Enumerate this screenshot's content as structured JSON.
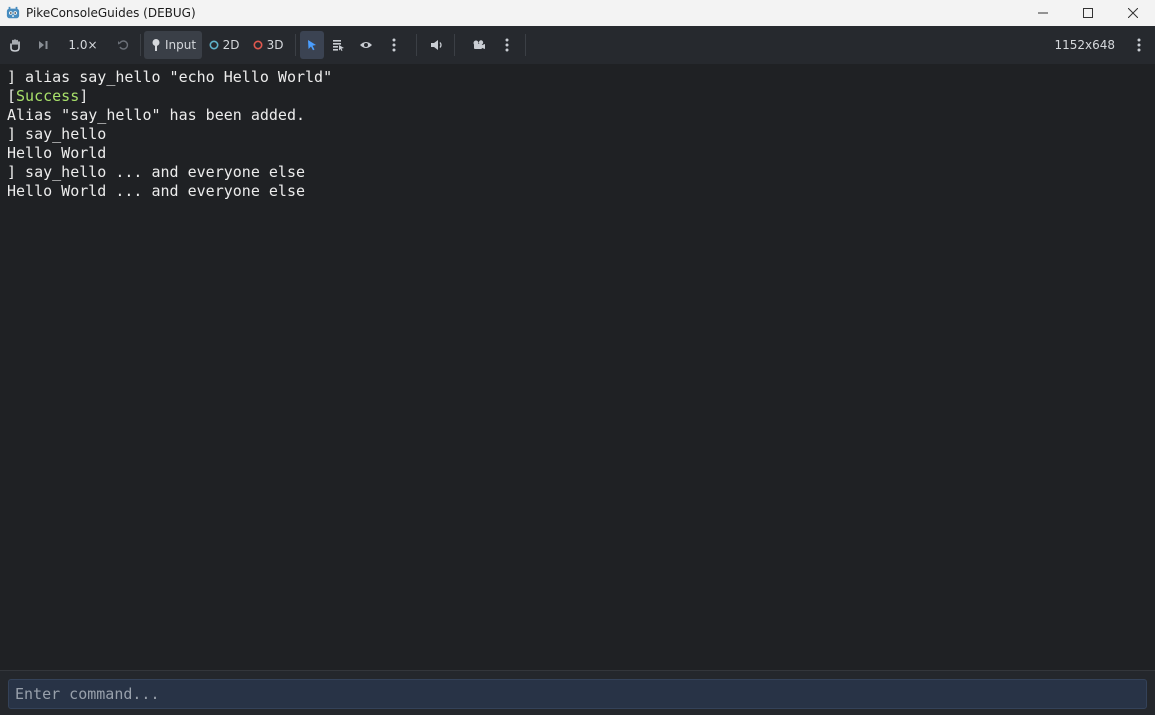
{
  "window": {
    "title": "PikeConsoleGuides (DEBUG)"
  },
  "toolbar": {
    "speed": "1.0×",
    "input_label": "Input",
    "mode_2d_label": "2D",
    "mode_3d_label": "3D",
    "resolution": "1152x648",
    "accent": "#4a9eff",
    "mode_2d_color": "#5fb2c9",
    "mode_3d_color": "#e0584e"
  },
  "console": {
    "lines": [
      "] alias say_hello \"echo Hello World\"",
      "[",
      "Success",
      "]",
      "Alias \"say_hello\" has been added.",
      "] say_hello",
      "Hello World",
      "] say_hello ... and everyone else",
      "Hello World ... and everyone else"
    ],
    "success_color": "#a8e06a"
  },
  "command": {
    "placeholder": "Enter command...",
    "value": ""
  }
}
